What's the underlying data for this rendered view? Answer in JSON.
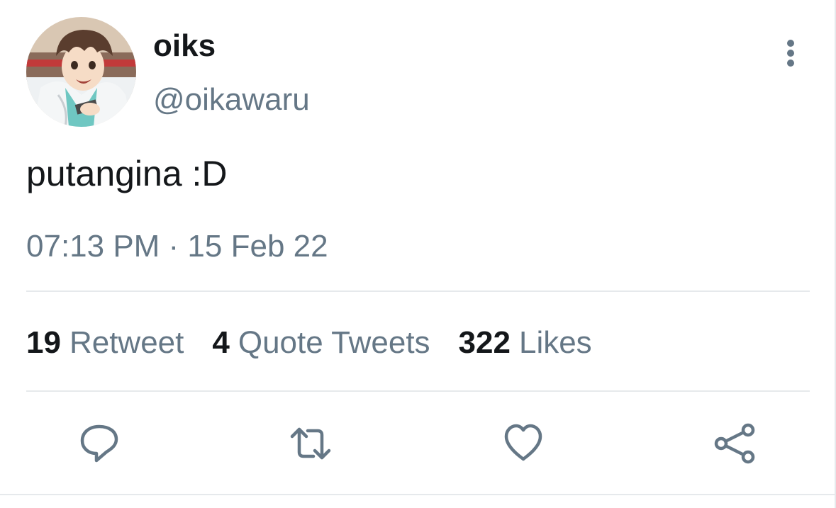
{
  "tweet": {
    "display_name": "oiks",
    "handle": "@oikawaru",
    "text": "putangina :D",
    "timestamp": "07:13 PM · 15 Feb 22",
    "avatar_icon": "anime-character-avatar"
  },
  "stats": {
    "retweets_count": "19",
    "retweets_label": "Retweet",
    "quotes_count": "4",
    "quotes_label": "Quote Tweets",
    "likes_count": "322",
    "likes_label": "Likes"
  },
  "actions": {
    "more_icon": "vertical-ellipsis-icon",
    "reply_icon": "reply-icon",
    "retweet_icon": "retweet-icon",
    "like_icon": "heart-icon",
    "share_icon": "share-icon"
  },
  "colors": {
    "primary_text": "#14171a",
    "secondary_text": "#657786",
    "divider": "#e6e9ec"
  }
}
